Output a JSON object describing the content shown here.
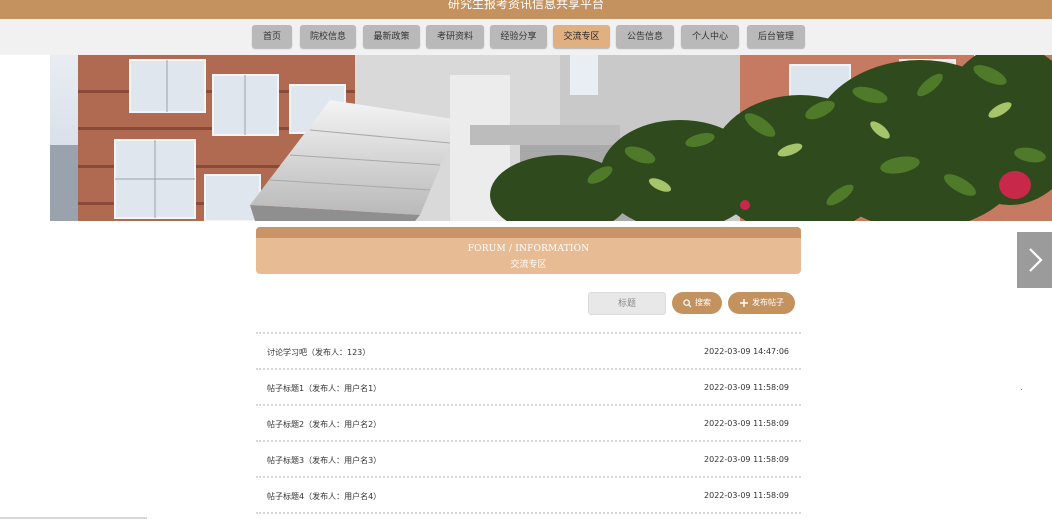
{
  "app": {
    "title": "研究生报考资讯信息共享平台"
  },
  "nav": {
    "items": [
      {
        "label": "首页"
      },
      {
        "label": "院校信息"
      },
      {
        "label": "最新政策"
      },
      {
        "label": "考研资料"
      },
      {
        "label": "经验分享"
      },
      {
        "label": "交流专区",
        "active": true
      },
      {
        "label": "公告信息"
      },
      {
        "label": "个人中心"
      },
      {
        "label": "后台管理"
      }
    ]
  },
  "section": {
    "en_title": "FORUM / INFORMATION",
    "cn_title": "交流专区"
  },
  "search": {
    "placeholder": "标题",
    "search_label": "搜索",
    "post_label": "发布帖子"
  },
  "posts": [
    {
      "title": "讨论学习吧（发布人：123）",
      "date": "2022-03-09 14:47:06"
    },
    {
      "title": "帖子标题1（发布人：用户名1）",
      "date": "2022-03-09 11:58:09"
    },
    {
      "title": "帖子标题2（发布人：用户名2）",
      "date": "2022-03-09 11:58:09"
    },
    {
      "title": "帖子标题3（发布人：用户名3）",
      "date": "2022-03-09 11:58:09"
    },
    {
      "title": "帖子标题4（发布人：用户名4）",
      "date": "2022-03-09 11:58:09"
    }
  ],
  "colors": {
    "brand": "#c4925f",
    "header_band": "#e7bb93",
    "nav_inactive": "#b9b9b9",
    "nav_active": "#e0b081"
  },
  "icons": {
    "next": "chevron-right-icon",
    "search": "search-icon",
    "post": "plus-icon"
  }
}
